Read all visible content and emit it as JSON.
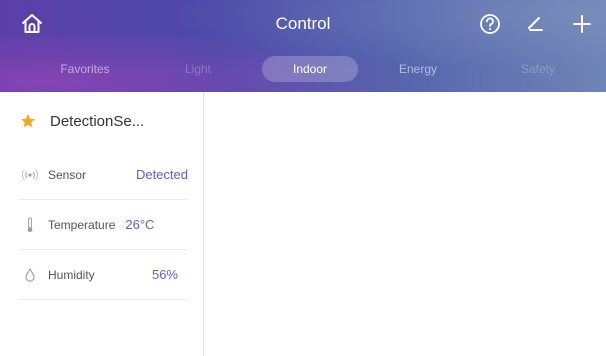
{
  "header": {
    "title": "Control",
    "icons": {
      "home": "home-icon",
      "help": "help-circle-icon",
      "edit": "edit-icon",
      "add": "plus-icon"
    }
  },
  "tabs": [
    {
      "label": "Favorites",
      "state": "inactive"
    },
    {
      "label": "Light",
      "state": "disabled"
    },
    {
      "label": "Indoor",
      "state": "active"
    },
    {
      "label": "Energy",
      "state": "inactive"
    },
    {
      "label": "Safety",
      "state": "disabled"
    }
  ],
  "device": {
    "name": "DetectionSe...",
    "favorite_icon": "star-icon",
    "rows": [
      {
        "icon": "sensor-icon",
        "label": "Sensor",
        "value": "Detected"
      },
      {
        "icon": "thermometer-icon",
        "label": "Temperature",
        "value": "26°C"
      },
      {
        "icon": "humidity-icon",
        "label": "Humidity",
        "value": "56%"
      }
    ]
  },
  "colors": {
    "header_gradient_start": "#5b3fa8",
    "header_gradient_end": "#6f84b6",
    "accent_value": "#5a64c8",
    "star": "#f5a623"
  }
}
